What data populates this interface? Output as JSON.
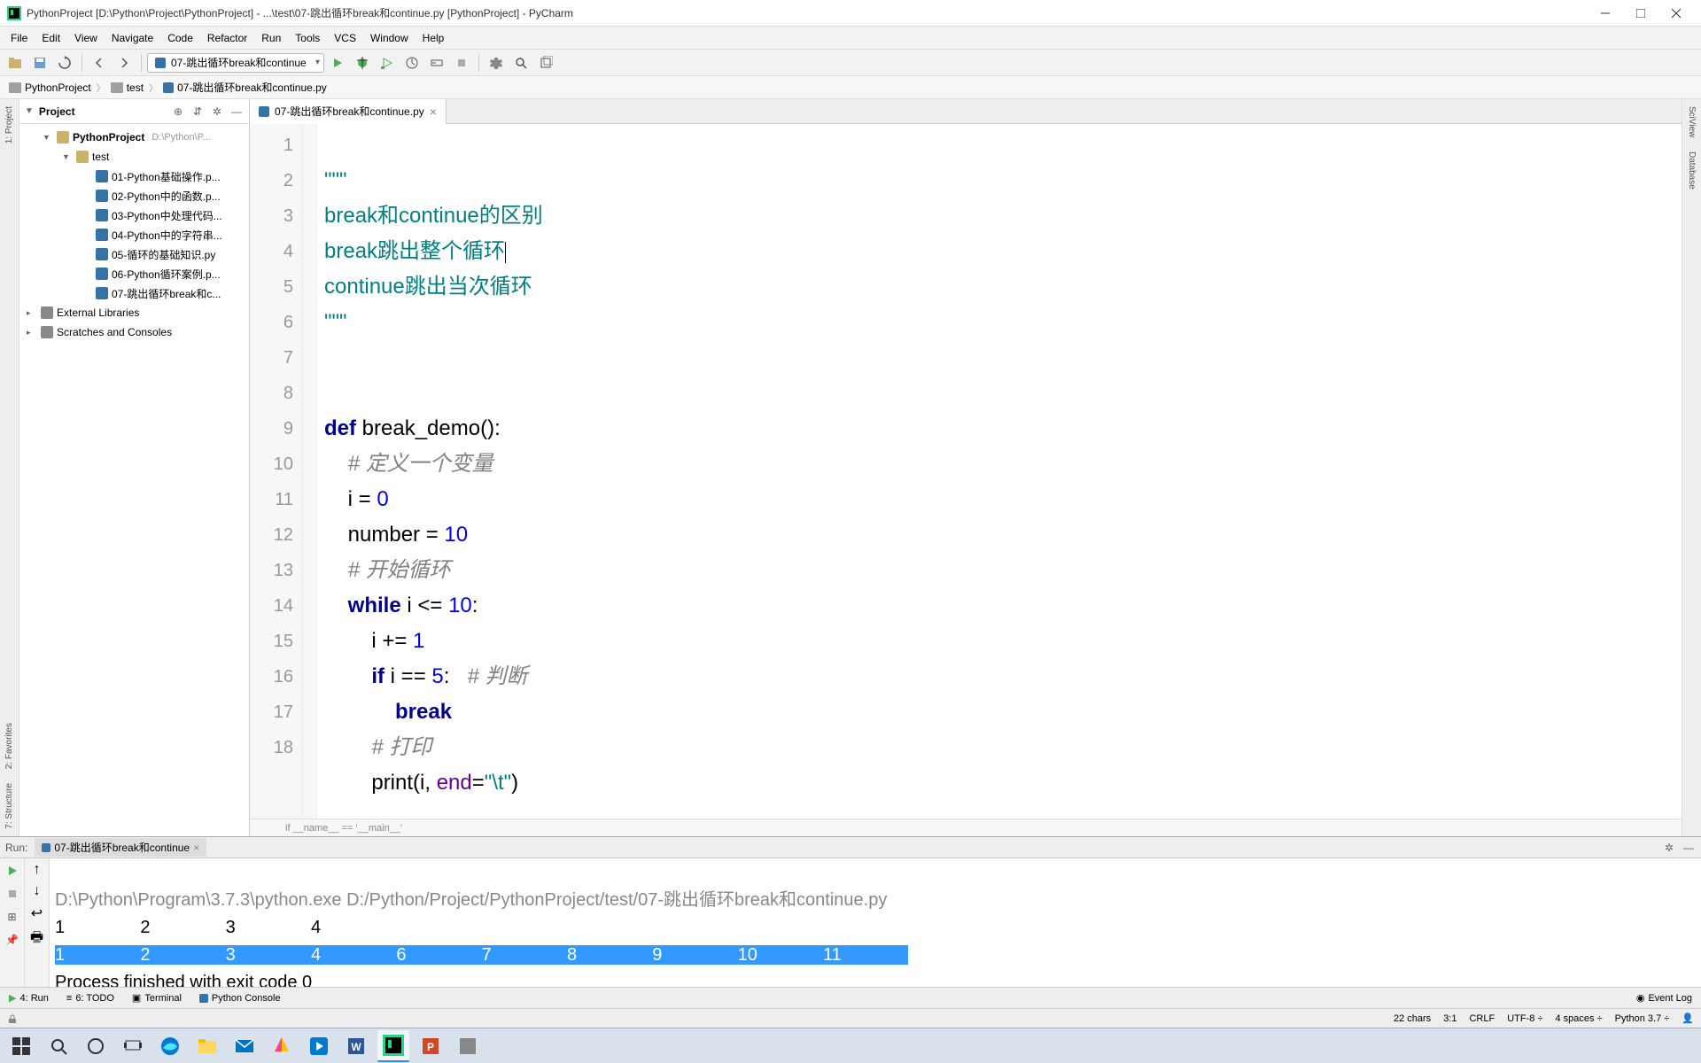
{
  "window": {
    "title": "PythonProject [D:\\Python\\Project\\PythonProject] - ...\\test\\07-跳出循环break和continue.py [PythonProject] - PyCharm"
  },
  "menu": [
    "File",
    "Edit",
    "View",
    "Navigate",
    "Code",
    "Refactor",
    "Run",
    "Tools",
    "VCS",
    "Window",
    "Help"
  ],
  "run_config": "07-跳出循环break和continue",
  "breadcrumbs": {
    "root": "PythonProject",
    "folder": "test",
    "file": "07-跳出循环break和continue.py"
  },
  "project": {
    "title": "Project",
    "root": {
      "name": "PythonProject",
      "path": "D:\\Python\\P..."
    },
    "test_folder": "test",
    "files": [
      "01-Python基础操作.p...",
      "02-Python中的函数.p...",
      "03-Python中处理代码...",
      "04-Python中的字符串...",
      "05-循环的基础知识.py",
      "06-Python循环案例.p...",
      "07-跳出循环break和c..."
    ],
    "external": "External Libraries",
    "scratches": "Scratches and Consoles"
  },
  "editor": {
    "tab": "07-跳出循环break和continue.py",
    "lines": [
      "1",
      "2",
      "3",
      "4",
      "5",
      "6",
      "7",
      "8",
      "9",
      "10",
      "11",
      "12",
      "13",
      "14",
      "15",
      "16",
      "17",
      "18"
    ],
    "code": {
      "l1": "\"\"\"",
      "l2": "break和continue的区别",
      "l3": "break跳出整个循环",
      "l4": "continue跳出当次循环",
      "l5": "\"\"\"",
      "l8_def": "def ",
      "l8_name": "break_demo",
      "l8_rest": "():",
      "l9": "# 定义一个变量",
      "l10_a": "i = ",
      "l10_b": "0",
      "l11_a": "number = ",
      "l11_b": "10",
      "l12": "# 开始循环",
      "l13_a": "while",
      "l13_b": " i <= ",
      "l13_c": "10",
      "l13_d": ":",
      "l14_a": "i += ",
      "l14_b": "1",
      "l15_a": "if",
      "l15_b": " i == ",
      "l15_c": "5",
      "l15_d": ":",
      "l15_e": "# 判断",
      "l16": "break",
      "l17": "# 打印",
      "l18_a": "print",
      "l18_b": "(i, ",
      "l18_c": "end",
      "l18_d": "=",
      "l18_e": "\"\\t\"",
      "l18_f": ")"
    },
    "bottom_crumb": "if __name__ == '__main__'"
  },
  "run": {
    "label": "Run:",
    "tab": "07-跳出循环break和continue",
    "cmdline": "D:\\Python\\Program\\3.7.3\\python.exe D:/Python/Project/PythonProject/test/07-跳出循环break和continue.py",
    "out1": "1\t2\t3\t4",
    "out2": "1\t2\t3\t4\t6\t7\t8\t9\t10\t11\t",
    "out3": "Process finished with exit code 0"
  },
  "bottom_tabs": {
    "run": "4: Run",
    "todo": "6: TODO",
    "terminal": "Terminal",
    "pyconsole": "Python Console",
    "eventlog": "Event Log"
  },
  "status": {
    "chars": "22 chars",
    "pos": "3:1",
    "sep": "CRLF",
    "enc": "UTF-8",
    "indent": "4 spaces",
    "python": "Python 3.7"
  },
  "right_rail": {
    "sciview": "SciView",
    "database": "Database"
  },
  "left_rail": {
    "project": "1: Project",
    "favorites": "2: Favorites",
    "structure": "7: Structure"
  }
}
